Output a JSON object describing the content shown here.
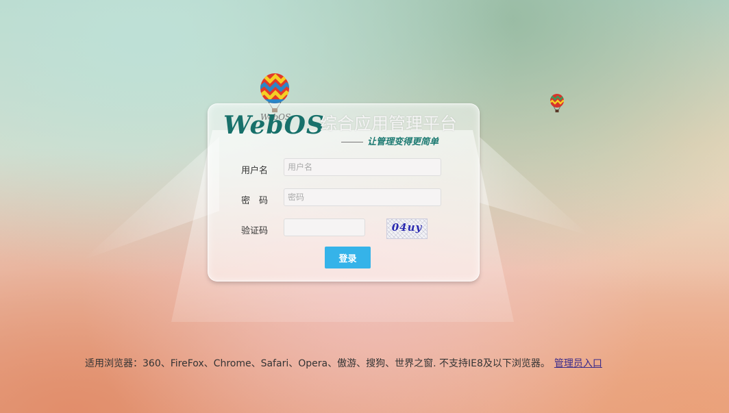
{
  "logo": {
    "brand": "WebOS",
    "brand_small": "WebOS"
  },
  "header": {
    "title": "综合应用管理平台",
    "slogan": "让管理变得更简单"
  },
  "form": {
    "username_label": "用户名",
    "username_placeholder": "用户名",
    "password_label": "密　码",
    "password_placeholder": "密码",
    "captcha_label": "验证码",
    "captcha_text": "04uy",
    "login_label": "登录"
  },
  "footer": {
    "browsers_text": "适用浏览器：360、FireFox、Chrome、Safari、Opera、傲游、搜狗、世界之窗. 不支持IE8及以下浏览器。",
    "admin_link": "管理员入口"
  },
  "colors": {
    "brand": "#17706a",
    "button": "#35b3e9",
    "link": "#3a2a8a"
  },
  "icons": [
    "hot-air-balloon-icon",
    "hot-air-balloon-small-icon"
  ]
}
